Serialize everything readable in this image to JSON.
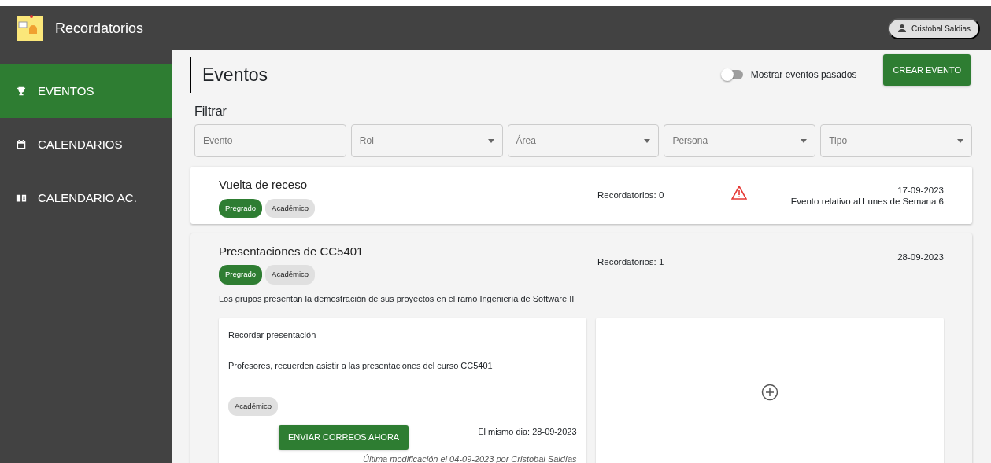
{
  "app": {
    "title": "Recordatorios",
    "user": "Cristobal Saldias"
  },
  "sidebar": {
    "items": [
      {
        "label": "EVENTOS",
        "selected": true
      },
      {
        "label": "CALENDARIOS",
        "selected": false
      },
      {
        "label": "CALENDARIO AC.",
        "selected": false
      }
    ]
  },
  "page": {
    "title": "Eventos",
    "toggle": {
      "label": "Mostrar eventos pasados",
      "on": false
    },
    "create_button": "CREAR EVENTO"
  },
  "filters": {
    "title": "Filtrar",
    "fields": [
      {
        "kind": "text",
        "placeholder": "Evento"
      },
      {
        "kind": "select",
        "placeholder": "Rol"
      },
      {
        "kind": "select",
        "placeholder": "Área"
      },
      {
        "kind": "select",
        "placeholder": "Persona"
      },
      {
        "kind": "select",
        "placeholder": "Tipo"
      }
    ]
  },
  "events": [
    {
      "title": "Vuelta de receso",
      "tags": [
        {
          "label": "Pregrado",
          "color": "#2e7d32"
        },
        {
          "label": "Académico",
          "color": "#e0e0e0"
        }
      ],
      "reminders": "Recordatorios: 0",
      "warning": true,
      "date_lines": [
        "17-09-2023",
        "Evento relativo al Lunes de Semana 6"
      ],
      "expanded": false
    },
    {
      "title": "Presentaciones de CC5401",
      "tags": [
        {
          "label": "Pregrado",
          "color": "#2e7d32"
        },
        {
          "label": "Académico",
          "color": "#e0e0e0"
        }
      ],
      "reminders": "Recordatorios: 1",
      "warning": false,
      "date_lines": [
        "28-09-2023"
      ],
      "expanded": true,
      "description": "Los grupos presentan la demostración de sus proyectos en el ramo Ingeniería de Software II",
      "reminder_cards": [
        {
          "title": "Recordar presentación",
          "message": "Profesores, recuerden asistir a las presentaciones del curso CC5401",
          "tags": [
            {
              "label": "Académico",
              "color": "#e0e0e0"
            }
          ],
          "send_button": "ENVIAR CORREOS AHORA",
          "when": "El mismo dia: 28-09-2023",
          "modified": "Última modificación el 04-09-2023 por Cristobal Saldías"
        }
      ]
    }
  ]
}
